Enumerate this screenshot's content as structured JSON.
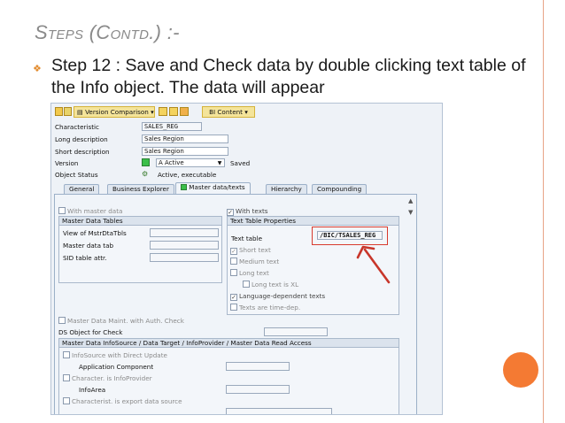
{
  "slide": {
    "title": "Steps (Contd.) :-",
    "bullet": "Step 12 : Save and Check data by double clicking text table of the Info object. The data will appear",
    "accent": "#f47a33"
  },
  "toolbar": {
    "version_comparison": "Version Comparison",
    "bi_content": "BI Content"
  },
  "header": {
    "characteristic_label": "Characteristic",
    "characteristic_value": "SALES_REG",
    "long_desc_label": "Long description",
    "long_desc_value": "Sales Region",
    "short_desc_label": "Short description",
    "short_desc_value": "Sales Region",
    "version_label": "Version",
    "version_value": "A Active",
    "version_status": "Saved",
    "object_status_label": "Object Status",
    "object_status_value": "Active, executable"
  },
  "tabs": [
    "General",
    "Business Explorer",
    "Master data/texts",
    "Hierarchy",
    "Compounding"
  ],
  "master": {
    "with_master_data": "With master data",
    "group_title": "Master Data Tables",
    "view_label": "View of MstrDtaTbls",
    "tab_label": "Master data tab",
    "sid_label": "SID table attr."
  },
  "texts": {
    "with_texts": "With texts",
    "group_title": "Text Table Properties",
    "text_table_label": "Text table",
    "text_table_value": "/BIC/TSALES_REG",
    "short_text": "Short text",
    "medium_text": "Medium text",
    "long_text": "Long text",
    "long_text_xl": "Long text is XL",
    "lang_dependent": "Language-dependent texts",
    "time_dep": "Texts are time-dep."
  },
  "bottom": {
    "auth_check": "Master Data Maint. with Auth. Check",
    "ds_object": "DS Object for Check",
    "group_title": "Master Data InfoSource / Data Target / InfoProvider / Master Data Read Access",
    "infosource_direct": "InfoSource with Direct Update",
    "app_component": "Application Component",
    "char_infoprovider": "Character. is InfoProvider",
    "infoarea": "InfoArea",
    "char_export": "Characterist. is export data source"
  }
}
